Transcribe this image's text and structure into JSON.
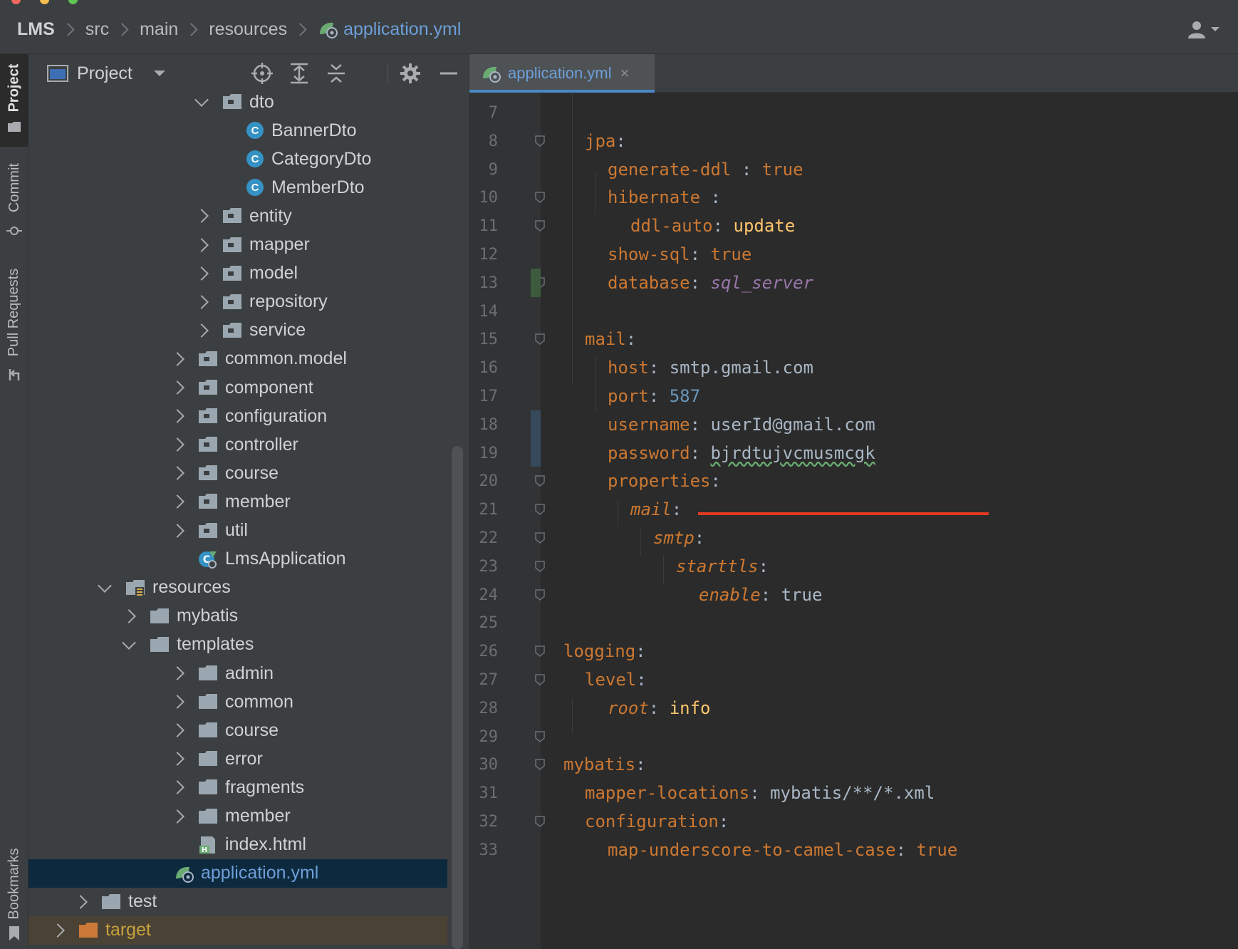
{
  "breadcrumb": {
    "project": "LMS",
    "parts": [
      "src",
      "main",
      "resources"
    ],
    "file": "application.yml"
  },
  "sidebar_strip": {
    "project": "Project",
    "commit": "Commit",
    "pull_requests": "Pull Requests",
    "bookmarks": "Bookmarks"
  },
  "project_panel": {
    "title": "Project",
    "tree": [
      {
        "label": "dto",
        "type": "folder",
        "state": "expanded"
      },
      {
        "label": "BannerDto",
        "type": "class"
      },
      {
        "label": "CategoryDto",
        "type": "class"
      },
      {
        "label": "MemberDto",
        "type": "class"
      },
      {
        "label": "entity",
        "type": "folder",
        "state": "collapsed"
      },
      {
        "label": "mapper",
        "type": "folder",
        "state": "collapsed"
      },
      {
        "label": "model",
        "type": "folder",
        "state": "collapsed"
      },
      {
        "label": "repository",
        "type": "folder",
        "state": "collapsed"
      },
      {
        "label": "service",
        "type": "folder",
        "state": "collapsed"
      },
      {
        "label": "common.model",
        "type": "folder",
        "state": "collapsed"
      },
      {
        "label": "component",
        "type": "folder",
        "state": "collapsed"
      },
      {
        "label": "configuration",
        "type": "folder",
        "state": "collapsed"
      },
      {
        "label": "controller",
        "type": "folder",
        "state": "collapsed"
      },
      {
        "label": "course",
        "type": "folder",
        "state": "collapsed"
      },
      {
        "label": "member",
        "type": "folder",
        "state": "collapsed"
      },
      {
        "label": "util",
        "type": "folder",
        "state": "collapsed"
      },
      {
        "label": "LmsApplication",
        "type": "spring-app"
      },
      {
        "label": "resources",
        "type": "resources-folder",
        "state": "expanded"
      },
      {
        "label": "mybatis",
        "type": "folder",
        "state": "collapsed"
      },
      {
        "label": "templates",
        "type": "folder",
        "state": "expanded"
      },
      {
        "label": "admin",
        "type": "folder",
        "state": "collapsed"
      },
      {
        "label": "common",
        "type": "folder",
        "state": "collapsed"
      },
      {
        "label": "course",
        "type": "folder",
        "state": "collapsed"
      },
      {
        "label": "error",
        "type": "folder",
        "state": "collapsed"
      },
      {
        "label": "fragments",
        "type": "folder",
        "state": "collapsed"
      },
      {
        "label": "member",
        "type": "folder",
        "state": "collapsed"
      },
      {
        "label": "index.html",
        "type": "html"
      },
      {
        "label": "application.yml",
        "type": "yml",
        "selected": true
      },
      {
        "label": "test",
        "type": "folder",
        "state": "collapsed"
      },
      {
        "label": "target",
        "type": "excluded-folder",
        "state": "collapsed"
      }
    ]
  },
  "editor": {
    "tab_label": "application.yml",
    "close_glyph": "×",
    "lines": [
      {
        "n": "7",
        "parts": []
      },
      {
        "n": "8",
        "parts": [
          {
            "c": "k",
            "t": "jpa"
          },
          {
            "c": "v",
            "t": ":"
          }
        ]
      },
      {
        "n": "9",
        "parts": [
          {
            "c": "k",
            "t": "generate-ddl "
          },
          {
            "c": "v",
            "t": ": "
          },
          {
            "c": "t",
            "t": "true"
          }
        ]
      },
      {
        "n": "10",
        "parts": [
          {
            "c": "k",
            "t": "hibernate "
          },
          {
            "c": "v",
            "t": ":"
          }
        ]
      },
      {
        "n": "11",
        "parts": [
          {
            "c": "k",
            "t": "ddl-auto"
          },
          {
            "c": "v",
            "t": ": "
          },
          {
            "c": "u",
            "t": "update"
          }
        ]
      },
      {
        "n": "12",
        "parts": [
          {
            "c": "k",
            "t": "show-sql"
          },
          {
            "c": "v",
            "t": ": "
          },
          {
            "c": "t",
            "t": "true"
          }
        ]
      },
      {
        "n": "13",
        "parts": [
          {
            "c": "k",
            "t": "database"
          },
          {
            "c": "v",
            "t": ": "
          },
          {
            "c": "it",
            "t": "sql_server"
          }
        ]
      },
      {
        "n": "14",
        "parts": []
      },
      {
        "n": "15",
        "parts": [
          {
            "c": "k",
            "t": "mail"
          },
          {
            "c": "v",
            "t": ":"
          }
        ]
      },
      {
        "n": "16",
        "parts": [
          {
            "c": "k",
            "t": "host"
          },
          {
            "c": "v",
            "t": ": smtp.gmail.com"
          }
        ]
      },
      {
        "n": "17",
        "parts": [
          {
            "c": "k",
            "t": "port"
          },
          {
            "c": "v",
            "t": ": "
          },
          {
            "c": "n",
            "t": "587"
          }
        ]
      },
      {
        "n": "18",
        "parts": [
          {
            "c": "k",
            "t": "username"
          },
          {
            "c": "v",
            "t": ": userId@gmail.com"
          }
        ]
      },
      {
        "n": "19",
        "parts": [
          {
            "c": "k",
            "t": "password"
          },
          {
            "c": "v",
            "t": ": "
          },
          {
            "c": "v squiggle",
            "t": "bjrdtujvcmusmcgk"
          }
        ]
      },
      {
        "n": "20",
        "parts": [
          {
            "c": "k",
            "t": "properties"
          },
          {
            "c": "v",
            "t": ":"
          }
        ]
      },
      {
        "n": "21",
        "parts": [
          {
            "c": "ki",
            "t": "mail"
          },
          {
            "c": "v",
            "t": ":"
          }
        ]
      },
      {
        "n": "22",
        "parts": [
          {
            "c": "ki",
            "t": "smtp"
          },
          {
            "c": "v",
            "t": ":"
          }
        ]
      },
      {
        "n": "23",
        "parts": [
          {
            "c": "ki",
            "t": "starttls"
          },
          {
            "c": "v",
            "t": ":"
          }
        ]
      },
      {
        "n": "24",
        "parts": [
          {
            "c": "ki",
            "t": "enable"
          },
          {
            "c": "v",
            "t": ": true"
          }
        ]
      },
      {
        "n": "25",
        "parts": []
      },
      {
        "n": "26",
        "parts": [
          {
            "c": "k",
            "t": "logging"
          },
          {
            "c": "v",
            "t": ":"
          }
        ]
      },
      {
        "n": "27",
        "parts": [
          {
            "c": "k",
            "t": "level"
          },
          {
            "c": "v",
            "t": ":"
          }
        ]
      },
      {
        "n": "28",
        "parts": [
          {
            "c": "ki",
            "t": "root"
          },
          {
            "c": "v",
            "t": ": "
          },
          {
            "c": "u",
            "t": "info"
          }
        ]
      },
      {
        "n": "29",
        "parts": []
      },
      {
        "n": "30",
        "parts": [
          {
            "c": "k",
            "t": "mybatis"
          },
          {
            "c": "v",
            "t": ":"
          }
        ]
      },
      {
        "n": "31",
        "parts": [
          {
            "c": "k",
            "t": "mapper-locations"
          },
          {
            "c": "v",
            "t": ": mybatis/**/*.xml"
          }
        ]
      },
      {
        "n": "32",
        "parts": [
          {
            "c": "k",
            "t": "configuration"
          },
          {
            "c": "v",
            "t": ":"
          }
        ]
      },
      {
        "n": "33",
        "parts": [
          {
            "c": "k",
            "t": "map-underscore-to-camel-case"
          },
          {
            "c": "v",
            "t": ": "
          },
          {
            "c": "t",
            "t": "true"
          }
        ]
      }
    ]
  },
  "colors": {
    "background": "#2b2b2b",
    "panel": "#3c3f41",
    "selection": "#0d293e",
    "key": "#cc7832",
    "link": "#6d9fd9",
    "annotation_underline": "#e03b24"
  }
}
